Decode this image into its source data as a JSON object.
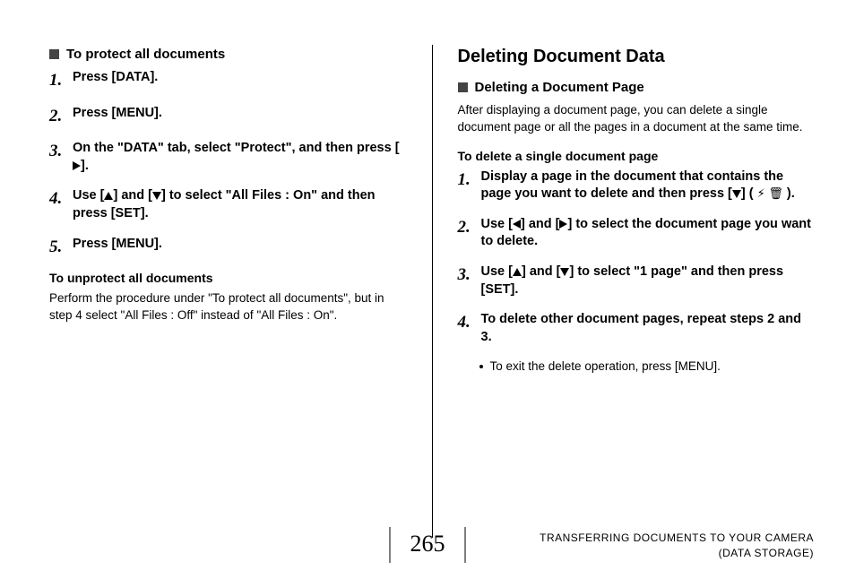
{
  "left": {
    "sectionTitle": "To protect all documents",
    "steps": [
      "Press [DATA].",
      "Press [MENU].",
      "On the \"DATA\" tab, select \"Protect\", and then press [RIGHT].",
      "Use [UP] and [DOWN] to select \"All Files : On\" and then press [SET].",
      "Press [MENU]."
    ],
    "subhead": "To unprotect all documents",
    "para": "Perform the procedure under \"To protect all documents\", but in step 4 select \"All Files : Off\" instead of \"All Files : On\"."
  },
  "right": {
    "h2": "Deleting Document Data",
    "sectionTitle": "Deleting a Document Page",
    "intro": "After displaying a document page, you can delete a single document page or all the pages in a document at the same time.",
    "subhead": "To delete a single document page",
    "steps": [
      "Display a page in the document that contains the page you want to delete and then press [DOWN] ( FLASHTRASH ).",
      "Use [LEFT] and [RIGHT] to select the document page you want to delete.",
      "Use [UP] and [DOWN] to select \"1 page\" and then press [SET].",
      "To delete other document pages, repeat steps 2 and 3."
    ],
    "bullet": "To exit the delete operation, press [MENU]."
  },
  "footer": {
    "pageNum": "265",
    "line1": "TRANSFERRING DOCUMENTS TO YOUR CAMERA",
    "line2": "(DATA STORAGE)"
  }
}
